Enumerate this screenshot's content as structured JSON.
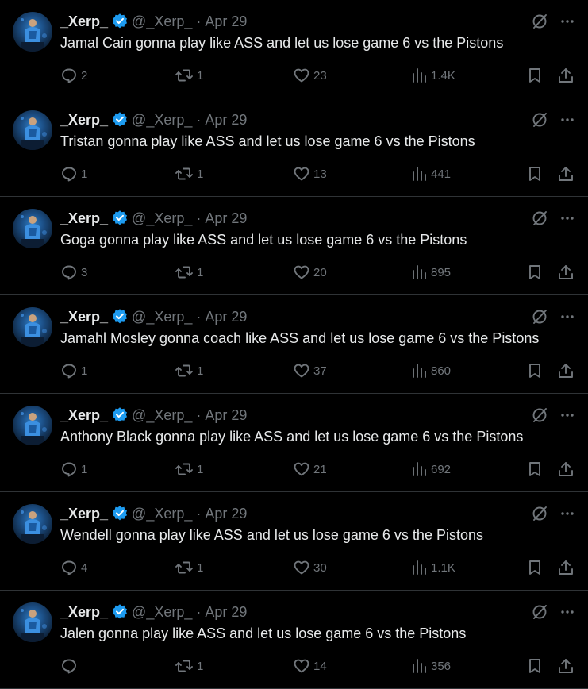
{
  "author": {
    "name": "_Xerp_",
    "handle": "@_Xerp_",
    "separator": "·",
    "date": "Apr 29"
  },
  "colors": {
    "background": "#000000",
    "text_primary": "#e7e9ea",
    "text_secondary": "#71767b",
    "verified_badge": "#1d9bf0",
    "divider": "#2f3336"
  },
  "icons": {
    "grok": "grok-icon",
    "more": "more-icon",
    "reply": "reply-icon",
    "retweet": "retweet-icon",
    "like": "like-icon",
    "views": "views-icon",
    "bookmark": "bookmark-icon",
    "share": "share-icon",
    "verified": "verified-badge-icon"
  },
  "tweets": [
    {
      "text": "Jamal Cain gonna play like ASS and let us lose game 6 vs the Pistons",
      "replies": "2",
      "retweets": "1",
      "likes": "23",
      "views": "1.4K"
    },
    {
      "text": "Tristan gonna play like ASS and let us lose game 6 vs the Pistons",
      "replies": "1",
      "retweets": "1",
      "likes": "13",
      "views": "441"
    },
    {
      "text": "Goga gonna play like ASS and let us lose game 6 vs the Pistons",
      "replies": "3",
      "retweets": "1",
      "likes": "20",
      "views": "895"
    },
    {
      "text": "Jamahl Mosley gonna coach like ASS and let us lose game 6 vs the Pistons",
      "replies": "1",
      "retweets": "1",
      "likes": "37",
      "views": "860"
    },
    {
      "text": "Anthony Black gonna play like ASS and let us lose game 6 vs the Pistons",
      "replies": "1",
      "retweets": "1",
      "likes": "21",
      "views": "692"
    },
    {
      "text": "Wendell gonna play like ASS and let us lose game 6 vs the Pistons",
      "replies": "4",
      "retweets": "1",
      "likes": "30",
      "views": "1.1K"
    },
    {
      "text": "Jalen gonna play like ASS and let us lose game 6 vs the Pistons",
      "replies": "",
      "retweets": "1",
      "likes": "14",
      "views": "356"
    }
  ]
}
